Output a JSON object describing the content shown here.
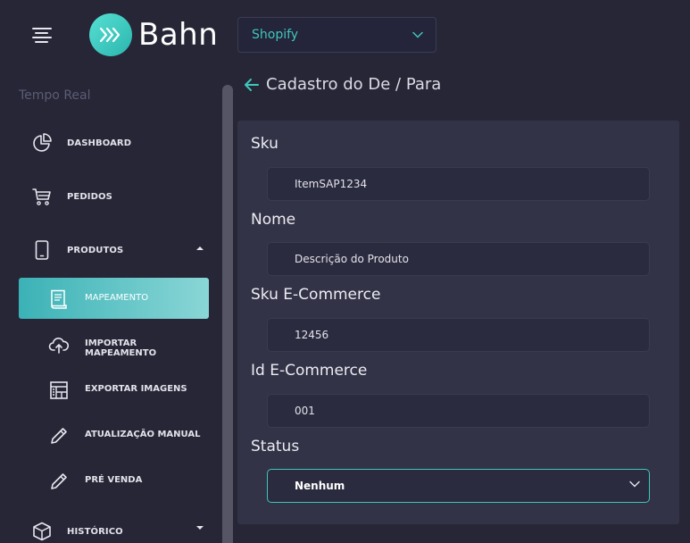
{
  "app": {
    "logo_text": "Bahn",
    "store_selector": {
      "value": "Shopify"
    }
  },
  "sidebar": {
    "section_title": "Tempo Real",
    "items": [
      {
        "label": "DASHBOARD",
        "icon": "pie-chart-icon"
      },
      {
        "label": "PEDIDOS",
        "icon": "cart-icon"
      },
      {
        "label": "PRODUTOS",
        "icon": "phone-icon",
        "expanded": true
      },
      {
        "label": "HISTÓRICO",
        "icon": "box-icon",
        "expanded": false
      }
    ],
    "sub_items": [
      {
        "label": "MAPEAMENTO",
        "icon": "document-icon",
        "active": true
      },
      {
        "label": "IMPORTAR MAPEAMENTO",
        "icon": "cloud-upload-icon"
      },
      {
        "label": "EXPORTAR IMAGENS",
        "icon": "export-images-icon"
      },
      {
        "label": "ATUALIZAÇÃO MANUAL",
        "icon": "pencil-icon"
      },
      {
        "label": "PRÉ VENDA",
        "icon": "pencil-icon"
      }
    ]
  },
  "page": {
    "title": "Cadastro do De / Para"
  },
  "form": {
    "sku": {
      "label": "Sku",
      "value": "ItemSAP1234"
    },
    "nome": {
      "label": "Nome",
      "value": "Descrição do Produto"
    },
    "sku_ecommerce": {
      "label": "Sku E-Commerce",
      "value": "12456"
    },
    "id_ecommerce": {
      "label": "Id E-Commerce",
      "value": "001"
    },
    "status": {
      "label": "Status",
      "value": "Nenhum"
    }
  },
  "colors": {
    "accent": "#3fc7ba",
    "background": "#262637",
    "card": "#333348"
  }
}
